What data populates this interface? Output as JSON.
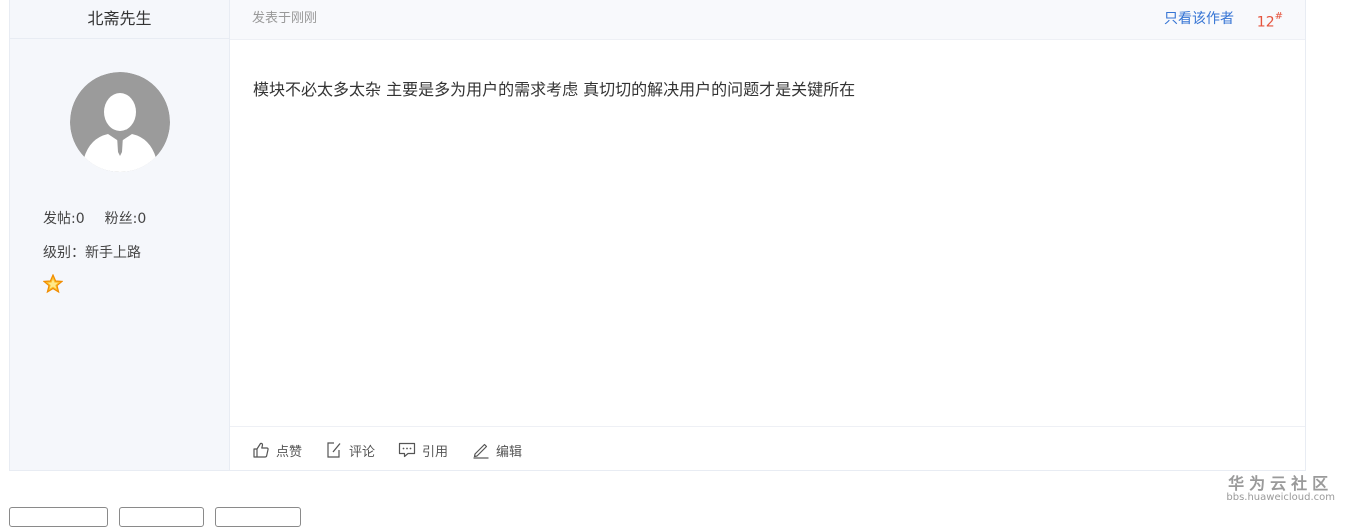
{
  "author": {
    "name": "北斋先生",
    "posts_label": "发帖:0",
    "fans_label": "粉丝:0",
    "level_label": "级别：新手上路"
  },
  "header": {
    "post_time": "发表于刚刚",
    "only_author": "只看该作者",
    "floor_number": "12",
    "floor_suffix": "#"
  },
  "content": {
    "text": "模块不必太多太杂 主要是多为用户的需求考虑 真切切的解决用户的问题才是关键所在"
  },
  "actions": {
    "like": "点赞",
    "comment": "评论",
    "quote": "引用",
    "edit": "编辑"
  },
  "watermark": {
    "title": "华为云社区",
    "subtitle": "bbs.huaweicloud.com"
  },
  "colors": {
    "link": "#3574d4",
    "floor": "#e5533d",
    "sidebar_bg": "#f5f7fb"
  }
}
